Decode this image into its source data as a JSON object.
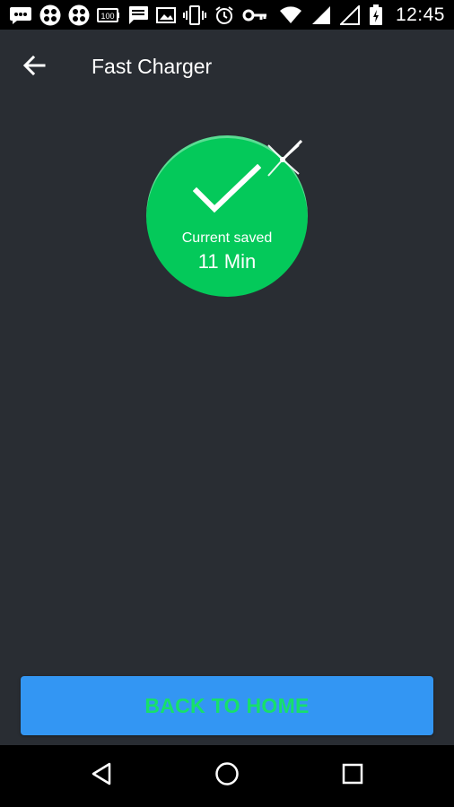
{
  "status_bar": {
    "time": "12:45",
    "icons_left": [
      "chat-dots-icon",
      "app-grid-icon",
      "app-grid-icon",
      "battery-100-icon",
      "message-icon",
      "image-icon",
      "vibrate-icon",
      "alarm-icon",
      "key-icon"
    ],
    "icons_right": [
      "wifi-icon",
      "signal-icon",
      "no-signal-icon",
      "battery-charging-icon"
    ],
    "battery_badge": "100"
  },
  "app_bar": {
    "title": "Fast Charger",
    "back_icon": "arrow-back-icon"
  },
  "result": {
    "caption": "Current saved",
    "value": "11 Min",
    "color": "#04c95a"
  },
  "actions": {
    "home_label": "BACK TO HOME",
    "button_color": "#3396f3",
    "label_color": "#17e06a"
  },
  "colors": {
    "background": "#292d33",
    "system_bars": "#000000"
  },
  "nav_bar": {
    "items": [
      "back-triangle-icon",
      "home-circle-icon",
      "recents-square-icon"
    ]
  }
}
